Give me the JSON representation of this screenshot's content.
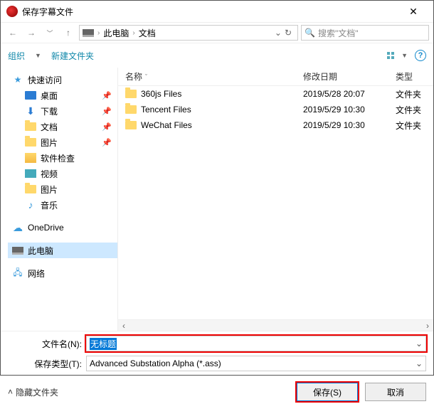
{
  "title": "保存字幕文件",
  "nav": {
    "pc": "此电脑",
    "docs": "文档"
  },
  "search": {
    "placeholder": "搜索\"文档\""
  },
  "toolbar": {
    "organize": "组织",
    "new_folder": "新建文件夹"
  },
  "columns": {
    "name": "名称",
    "date": "修改日期",
    "type": "类型"
  },
  "sidebar": {
    "quick": "快速访问",
    "desktop": "桌面",
    "downloads": "下载",
    "docs": "文档",
    "pictures": "图片",
    "swcheck": "软件检查",
    "video": "视频",
    "pictures2": "图片",
    "music": "音乐",
    "onedrive": "OneDrive",
    "thispc": "此电脑",
    "network": "网络"
  },
  "files": [
    {
      "name": "360js Files",
      "date": "2019/5/28 20:07",
      "type": "文件夹"
    },
    {
      "name": "Tencent Files",
      "date": "2019/5/29 10:30",
      "type": "文件夹"
    },
    {
      "name": "WeChat Files",
      "date": "2019/5/29 10:30",
      "type": "文件夹"
    }
  ],
  "footer": {
    "filename_label": "文件名(N):",
    "filename_value": "无标题",
    "filetype_label": "保存类型(T):",
    "filetype_value": "Advanced Substation Alpha (*.ass)",
    "hide_folders": "隐藏文件夹",
    "save": "保存(S)",
    "cancel": "取消"
  }
}
